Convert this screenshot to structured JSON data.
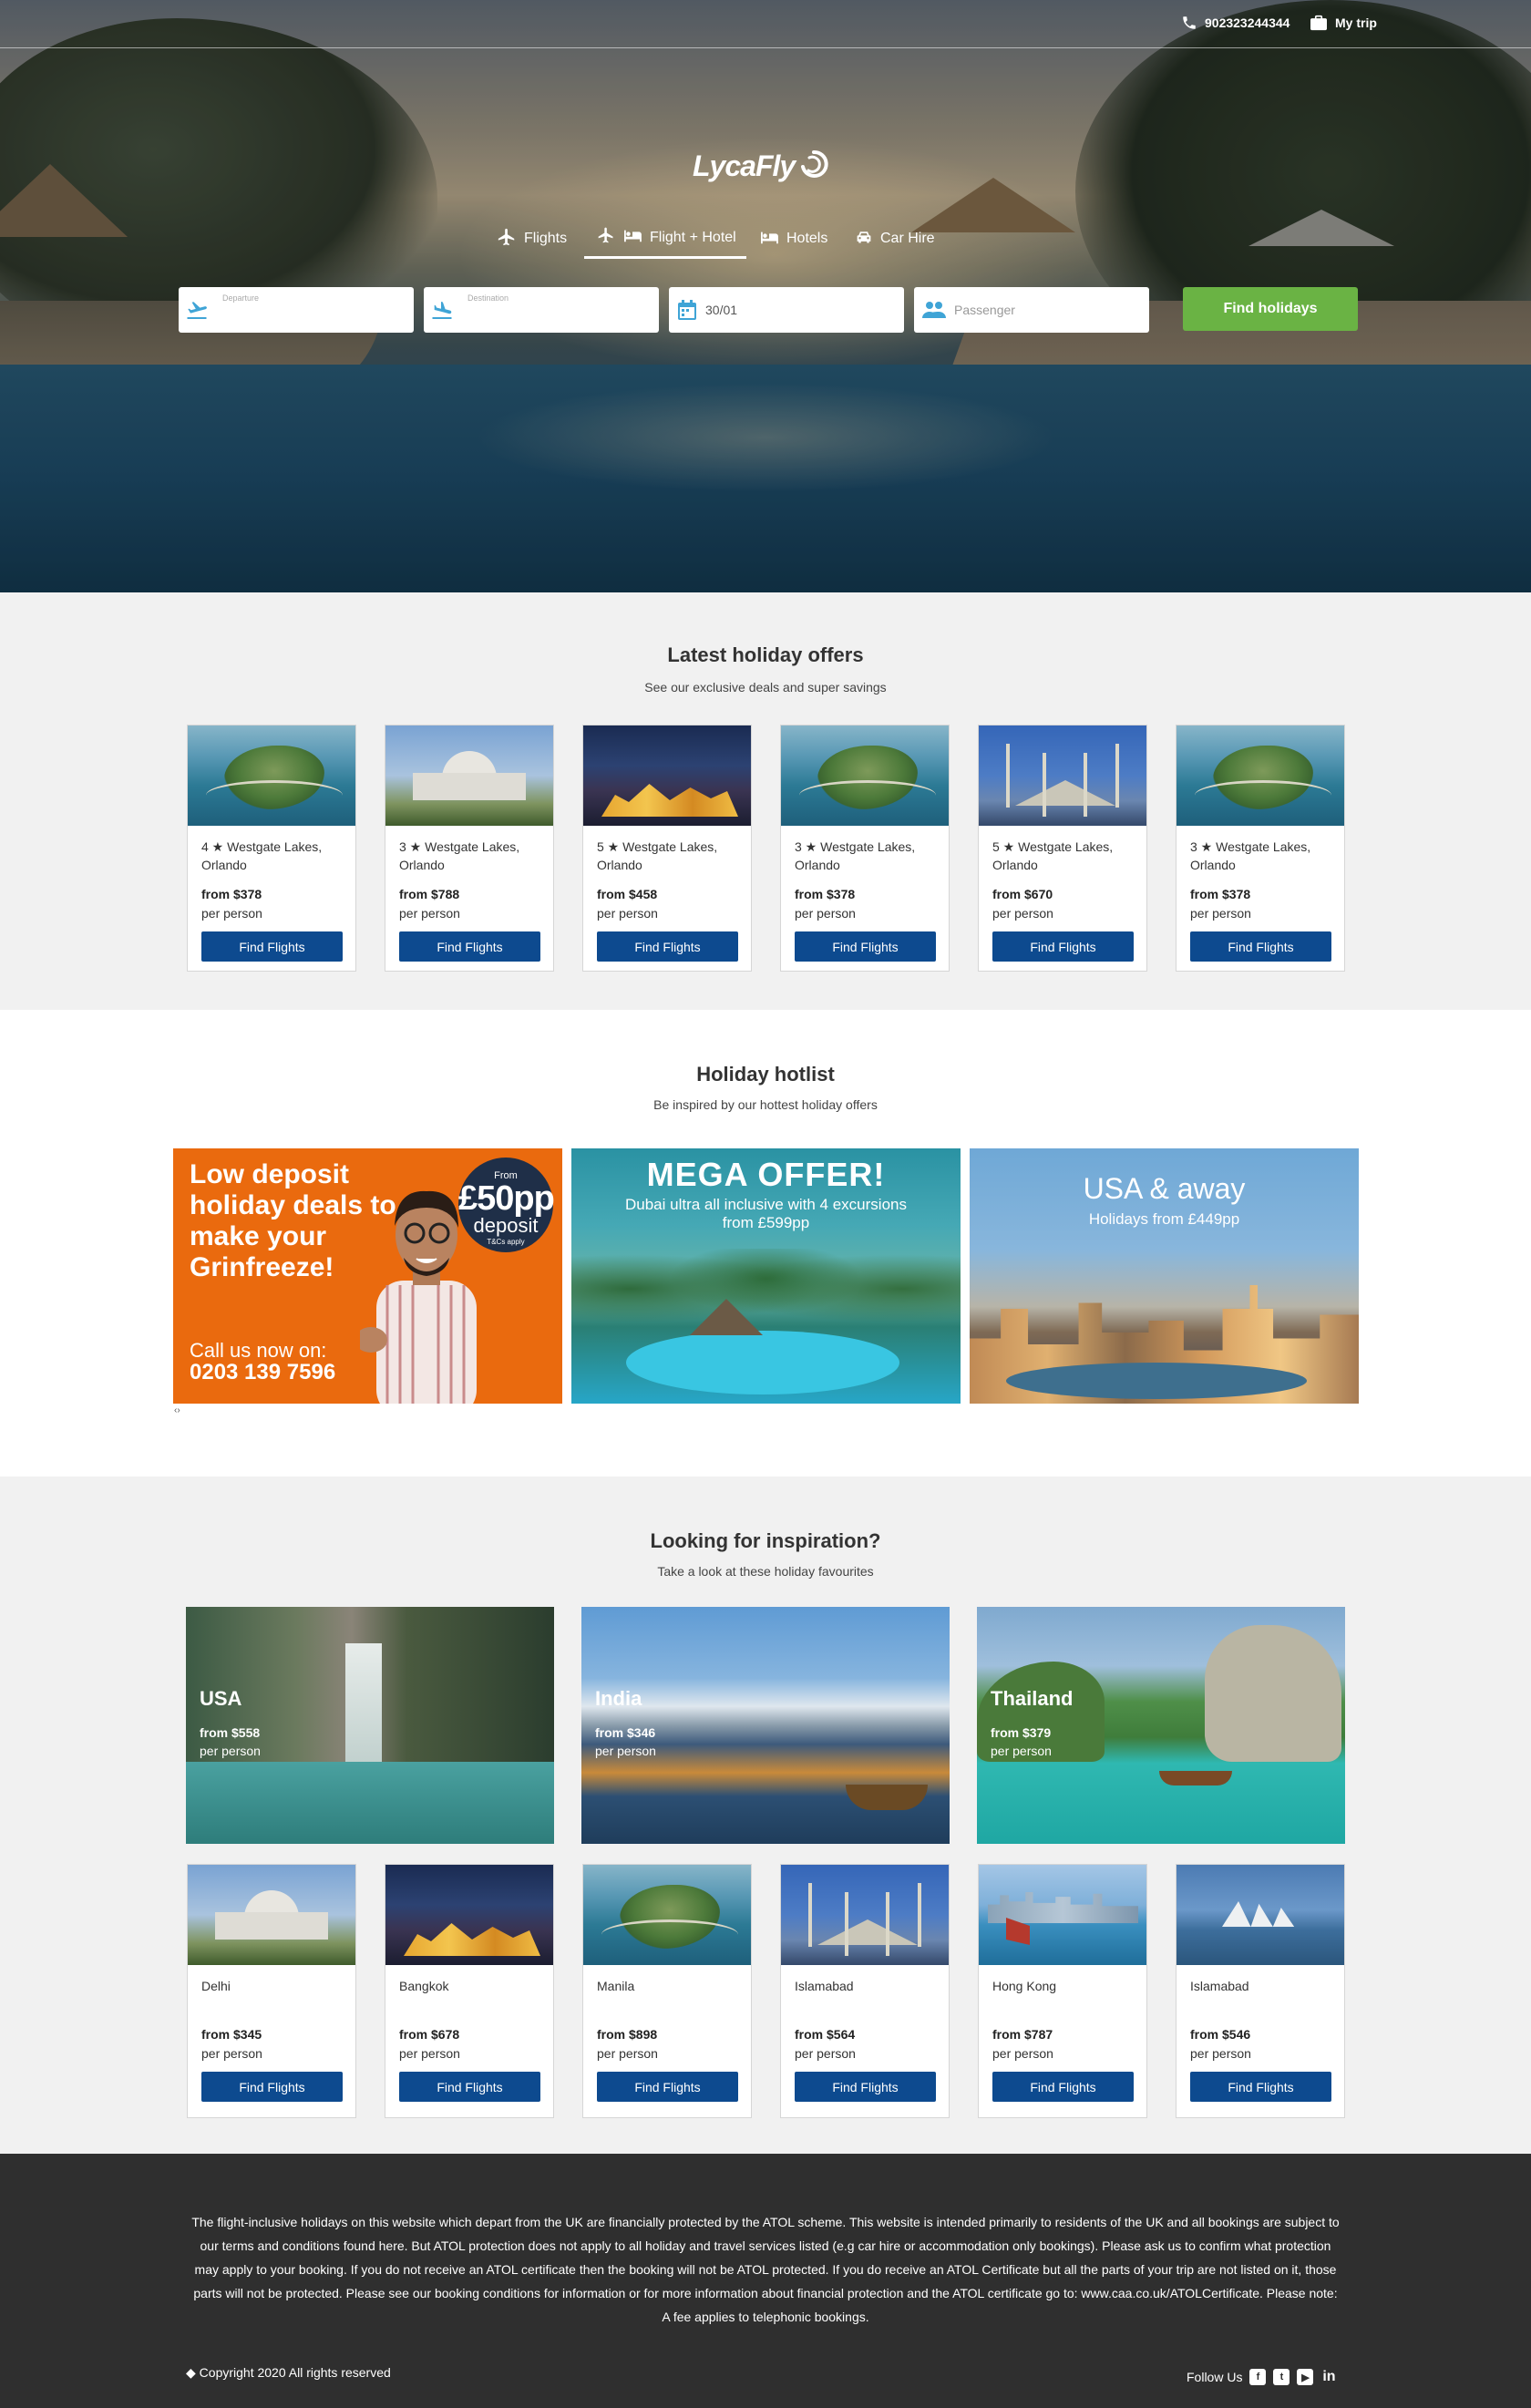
{
  "topbar": {
    "phone": "902323244344",
    "my_trip": "My trip"
  },
  "logo": {
    "text": "LycaFly"
  },
  "tabs": [
    {
      "label": "Flights"
    },
    {
      "label": "Flight + Hotel"
    },
    {
      "label": "Hotels"
    },
    {
      "label": "Car Hire"
    }
  ],
  "search": {
    "departure_placeholder": "Departure",
    "destination_placeholder": "Destination",
    "date_value": "30/01",
    "passenger_placeholder": "Passenger",
    "find_button": "Find holidays"
  },
  "latest": {
    "title": "Latest holiday offers",
    "subtitle": "See our exclusive deals and super savings",
    "cards": [
      {
        "stars": "4",
        "name": "Westgate Lakes, Orlando",
        "price": "from $378",
        "per": "per person",
        "button": "Find Flights",
        "scene": "island"
      },
      {
        "stars": "3",
        "name": "Westgate Lakes, Orlando",
        "price": "from $788",
        "per": "per person",
        "button": "Find Flights",
        "scene": "taj"
      },
      {
        "stars": "5",
        "name": "Westgate Lakes, Orlando",
        "price": "from $458",
        "per": "per person",
        "button": "Find Flights",
        "scene": "bangkok"
      },
      {
        "stars": "3",
        "name": "Westgate Lakes, Orlando",
        "price": "from $378",
        "per": "per person",
        "button": "Find Flights",
        "scene": "island"
      },
      {
        "stars": "5",
        "name": "Westgate Lakes, Orlando",
        "price": "from $670",
        "per": "per person",
        "button": "Find Flights",
        "scene": "mosque"
      },
      {
        "stars": "3",
        "name": "Westgate Lakes, Orlando",
        "price": "from $378",
        "per": "per person",
        "button": "Find Flights",
        "scene": "island"
      }
    ]
  },
  "hotlist": {
    "title": "Holiday hotlist",
    "subtitle": "Be inspired by our hottest holiday offers",
    "banner1": {
      "headline": "Low deposit holiday deals to make your Grinfreeze!",
      "call": "Call us now on:",
      "phone": "0203 139 7596",
      "badge_from": "From",
      "badge_amount": "£50pp",
      "badge_deposit": "deposit",
      "badge_tc": "T&Cs apply"
    },
    "banner2": {
      "title": "MEGA OFFER!",
      "line1": "Dubai ultra all inclusive with 4 excursions",
      "line2": "from £599pp"
    },
    "banner3": {
      "title": "USA & away",
      "line1": "Holidays from £449pp"
    },
    "arrows": "‹›"
  },
  "inspiration": {
    "title": "Looking for inspiration?",
    "subtitle": "Take a look at these holiday favourites",
    "big": [
      {
        "name": "USA",
        "price": "from $558",
        "per": "per person"
      },
      {
        "name": "India",
        "price": "from $346",
        "per": "per person"
      },
      {
        "name": "Thailand",
        "price": "from $379",
        "per": "per person"
      }
    ],
    "cards": [
      {
        "name": "Delhi",
        "price": "from $345",
        "per": "per person",
        "button": "Find Flights",
        "scene": "taj"
      },
      {
        "name": "Bangkok",
        "price": "from $678",
        "per": "per person",
        "button": "Find Flights",
        "scene": "bangkok"
      },
      {
        "name": "Manila",
        "price": "from $898",
        "per": "per person",
        "button": "Find Flights",
        "scene": "island"
      },
      {
        "name": "Islamabad",
        "price": "from $564",
        "per": "per person",
        "button": "Find Flights",
        "scene": "mosque"
      },
      {
        "name": "Hong Kong",
        "price": "from $787",
        "per": "per person",
        "button": "Find Flights",
        "scene": "hk"
      },
      {
        "name": "Islamabad",
        "price": "from $546",
        "per": "per person",
        "button": "Find Flights",
        "scene": "sydney"
      }
    ]
  },
  "footer": {
    "note": "The flight-inclusive holidays on this website which depart from the UK are financially protected by the ATOL scheme. This website is intended primarily to residents of the UK and all bookings are subject to our terms and conditions found here. But ATOL protection does not apply to all holiday and travel services listed (e.g car hire or accommodation only bookings). Please ask us to confirm what protection may apply to your booking. If you do not receive an ATOL certificate then the booking will not be ATOL protected. If you do receive an ATOL Certificate but all the parts of your trip are not listed on it, those parts will not be protected. Please see our booking conditions for information or for more information about financial protection and the ATOL certificate go to: www.caa.co.uk/ATOLCertificate. Please note: A fee applies to telephonic bookings.",
    "copyright": "Copyright 2020 All rights reserved",
    "follow": "Follow Us"
  },
  "colors": {
    "primary_button": "#0d4a8f",
    "find_holidays": "#6ab344",
    "footer_bg": "#2f2f2f",
    "section_bg": "#f1f1f1"
  }
}
